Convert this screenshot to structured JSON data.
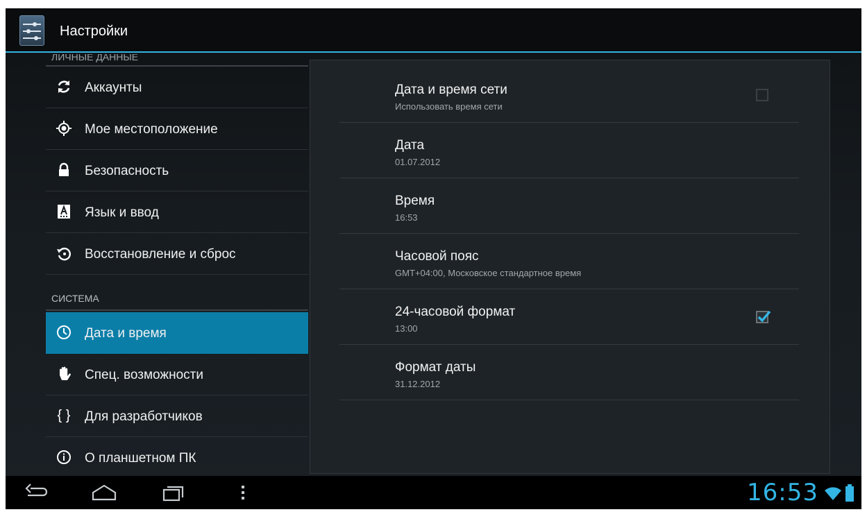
{
  "action_bar": {
    "title": "Настройки"
  },
  "left_list": {
    "partial_header": "ЛИЧНЫЕ ДАННЫЕ",
    "items": [
      {
        "label": "Аккаунты",
        "icon": "sync-icon"
      },
      {
        "label": "Мое местоположение",
        "icon": "location-icon"
      },
      {
        "label": "Безопасность",
        "icon": "lock-icon"
      },
      {
        "label": "Язык и ввод",
        "icon": "language-icon"
      },
      {
        "label": "Восстановление и сброс",
        "icon": "restore-icon"
      }
    ],
    "section_header": "СИСТЕМА",
    "system_items": [
      {
        "label": "Дата и время",
        "icon": "clock-icon",
        "selected": true
      },
      {
        "label": "Спец. возможности",
        "icon": "hand-icon"
      },
      {
        "label": "Для разработчиков",
        "icon": "braces-icon"
      },
      {
        "label": "О планшетном ПК",
        "icon": "info-icon"
      }
    ]
  },
  "settings": [
    {
      "title": "Дата и время сети",
      "summary": "Использовать время сети",
      "checkbox": true,
      "checked": false
    },
    {
      "title": "Дата",
      "summary": "01.07.2012"
    },
    {
      "title": "Время",
      "summary": "16:53"
    },
    {
      "title": "Часовой пояс",
      "summary": "GMT+04:00, Московское стандартное время"
    },
    {
      "title": "24-часовой формат",
      "summary": "13:00",
      "checkbox": true,
      "checked": true
    },
    {
      "title": "Формат даты",
      "summary": "31.12.2012"
    }
  ],
  "status_bar": {
    "clock": "16:53"
  },
  "colors": {
    "accent": "#33b5e5",
    "selected": "#0b7ea8"
  }
}
